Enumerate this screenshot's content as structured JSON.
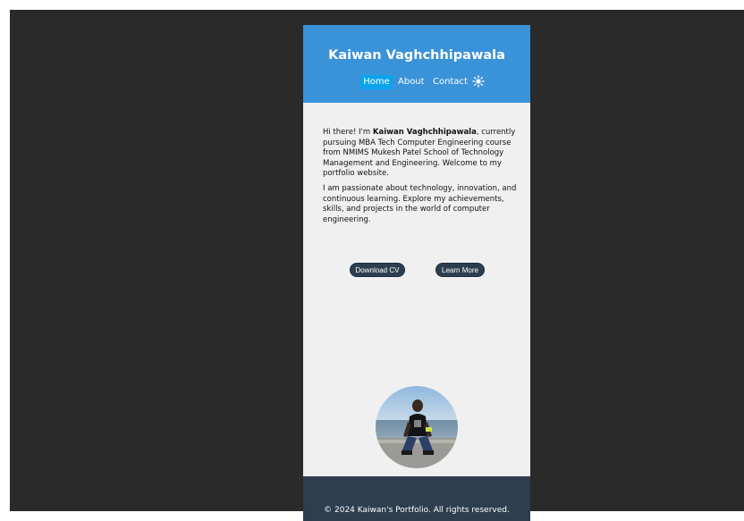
{
  "header": {
    "title": "Kaiwan Vaghchhipawala"
  },
  "nav": {
    "items": [
      {
        "label": "Home",
        "active": true
      },
      {
        "label": "About",
        "active": false
      },
      {
        "label": "Contact",
        "active": false
      }
    ],
    "theme_toggle_icon": "sun-icon"
  },
  "intro": {
    "greeting": "Hi there! I'm ",
    "name": "Kaiwan Vaghchhipawala",
    "rest": ", currently pursuing MBA Tech Computer Engineering course from NMIMS Mukesh Patel School of Technology Management and Engineering. Welcome to my portfolio website.",
    "paragraph2": "I am passionate about technology, innovation, and continuous learning. Explore my achievements, skills, and projects in the world of computer engineering."
  },
  "buttons": {
    "download_cv": "Download CV",
    "learn_more": "Learn More"
  },
  "profile": {
    "photo_icon": "profile-photo"
  },
  "footer": {
    "text": "© 2024 Kaiwan's Portfolio. All rights reserved."
  },
  "colors": {
    "header_bg": "#3a92d9",
    "nav_active": "#0aa4ee",
    "button_bg": "#2c3e50",
    "footer_bg": "#2c3e50",
    "page_bg": "#f0f0f0",
    "backdrop": "#2a2a2a"
  }
}
